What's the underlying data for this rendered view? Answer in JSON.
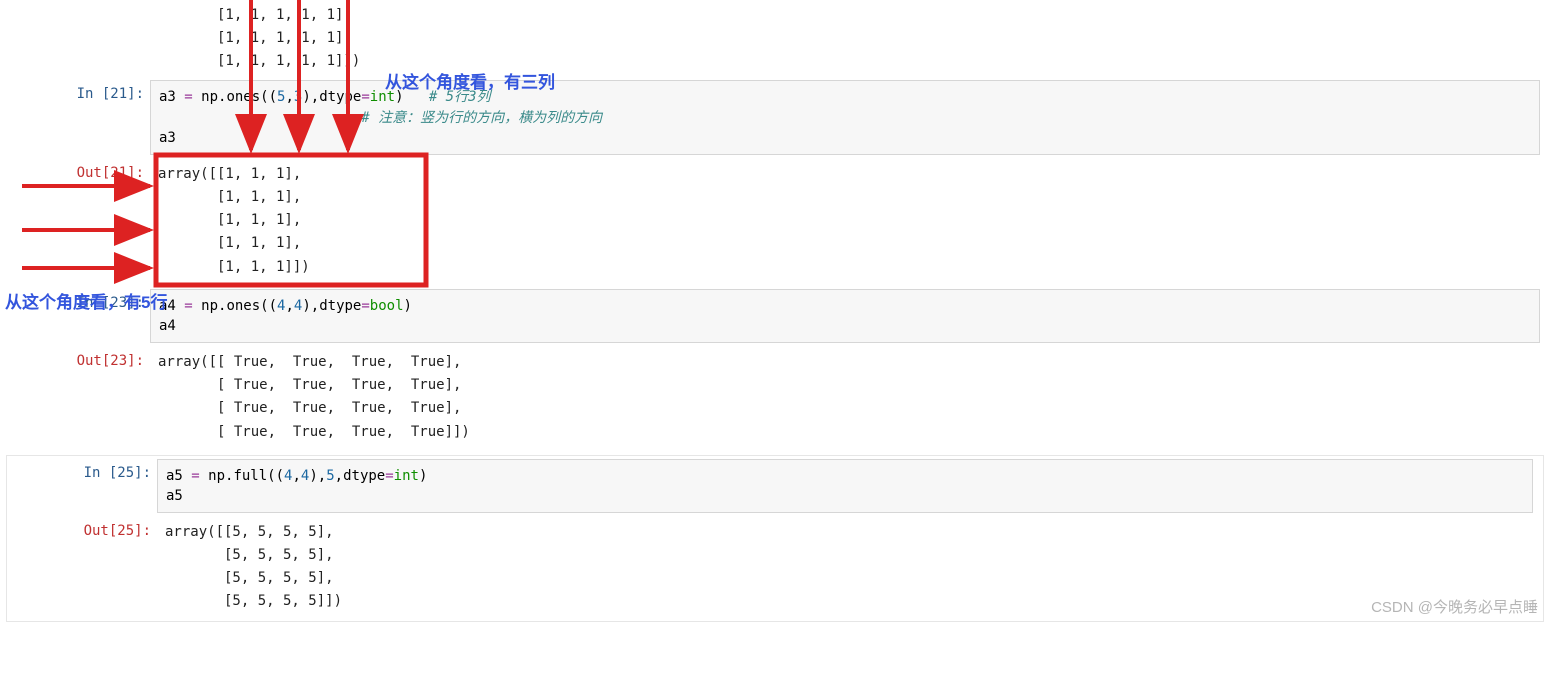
{
  "top_output_fragment": "       [1, 1, 1, 1, 1],\n       [1, 1, 1, 1, 1],\n       [1, 1, 1, 1, 1]])",
  "cells": {
    "c21": {
      "in_prompt": "In  [21]:",
      "out_prompt": "Out[21]:",
      "code_tokens": [
        {
          "t": "a3 ",
          "c": "tk-var"
        },
        {
          "t": "=",
          "c": "tk-op"
        },
        {
          "t": " np.ones",
          "c": "tk-var"
        },
        {
          "t": "((",
          "c": ""
        },
        {
          "t": "5",
          "c": "tk-num"
        },
        {
          "t": ",",
          "c": ""
        },
        {
          "t": "3",
          "c": "tk-num"
        },
        {
          "t": ")",
          "c": ""
        },
        {
          "t": ",dtype",
          "c": "tk-var"
        },
        {
          "t": "=",
          "c": "tk-op"
        },
        {
          "t": "int",
          "c": "tk-builtin"
        },
        {
          "t": ")   ",
          "c": ""
        },
        {
          "t": "# 5行3列",
          "c": "tk-comment"
        },
        {
          "t": "\n",
          "c": ""
        },
        {
          "t": "                        ",
          "c": ""
        },
        {
          "t": "# 注意：竖为行的方向，横为列的方向",
          "c": "tk-comment"
        },
        {
          "t": "\na3",
          "c": "tk-var"
        }
      ],
      "output": "array([[1, 1, 1],\n       [1, 1, 1],\n       [1, 1, 1],\n       [1, 1, 1],\n       [1, 1, 1]])"
    },
    "c23": {
      "in_prompt": "In  [23]:",
      "out_prompt": "Out[23]:",
      "code_tokens": [
        {
          "t": "a4 ",
          "c": "tk-var"
        },
        {
          "t": "=",
          "c": "tk-op"
        },
        {
          "t": " np.ones",
          "c": "tk-var"
        },
        {
          "t": "((",
          "c": ""
        },
        {
          "t": "4",
          "c": "tk-num"
        },
        {
          "t": ",",
          "c": ""
        },
        {
          "t": "4",
          "c": "tk-num"
        },
        {
          "t": ")",
          "c": ""
        },
        {
          "t": ",dtype",
          "c": "tk-var"
        },
        {
          "t": "=",
          "c": "tk-op"
        },
        {
          "t": "bool",
          "c": "tk-builtin"
        },
        {
          "t": ")",
          "c": ""
        },
        {
          "t": "\na4",
          "c": "tk-var"
        }
      ],
      "output": "array([[ True,  True,  True,  True],\n       [ True,  True,  True,  True],\n       [ True,  True,  True,  True],\n       [ True,  True,  True,  True]])"
    },
    "c25": {
      "in_prompt": "In  [25]:",
      "out_prompt": "Out[25]:",
      "code_tokens": [
        {
          "t": "a5 ",
          "c": "tk-var"
        },
        {
          "t": "=",
          "c": "tk-op"
        },
        {
          "t": " np.full",
          "c": "tk-var"
        },
        {
          "t": "((",
          "c": ""
        },
        {
          "t": "4",
          "c": "tk-num"
        },
        {
          "t": ",",
          "c": ""
        },
        {
          "t": "4",
          "c": "tk-num"
        },
        {
          "t": ")",
          "c": ""
        },
        {
          "t": ",",
          "c": ""
        },
        {
          "t": "5",
          "c": "tk-num"
        },
        {
          "t": ",dtype",
          "c": "tk-var"
        },
        {
          "t": "=",
          "c": "tk-op"
        },
        {
          "t": "int",
          "c": "tk-builtin"
        },
        {
          "t": ")",
          "c": ""
        },
        {
          "t": "\na5",
          "c": "tk-var"
        }
      ],
      "output": "array([[5, 5, 5, 5],\n       [5, 5, 5, 5],\n       [5, 5, 5, 5],\n       [5, 5, 5, 5]])"
    }
  },
  "annotations": {
    "top_label": "从这个角度看，有三列",
    "bottom_label": "从这个角度看，有5行"
  },
  "watermark": "CSDN @今晚务必早点睡"
}
